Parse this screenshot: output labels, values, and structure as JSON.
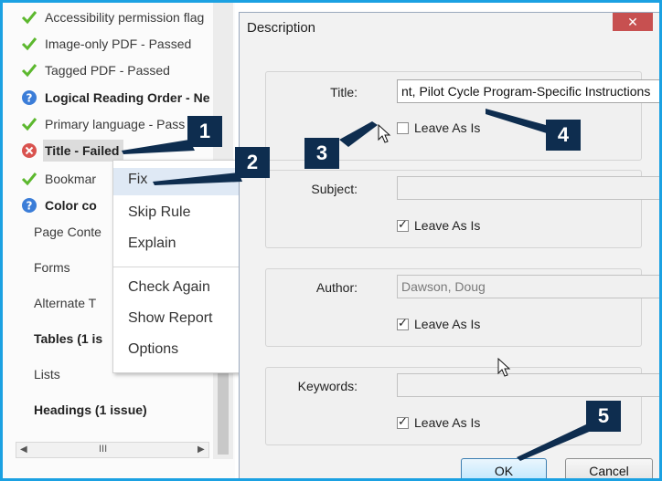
{
  "left_panel": {
    "items": [
      {
        "label": "Accessibility permission flag",
        "status": "passed"
      },
      {
        "label": "Image-only PDF - Passed",
        "status": "passed"
      },
      {
        "label": "Tagged PDF - Passed",
        "status": "passed"
      },
      {
        "label": "Logical Reading Order - Ne",
        "status": "manual"
      },
      {
        "label": "Primary language - Pass",
        "status": "passed"
      },
      {
        "label": "Title - Failed",
        "status": "failed"
      },
      {
        "label": "Bookmar",
        "status": "passed"
      },
      {
        "label": "Color co",
        "status": "manual"
      }
    ],
    "categories": [
      "Page Conte",
      "Forms",
      "Alternate T",
      "Tables (1 is",
      "Lists",
      "Headings (1 issue)"
    ],
    "scroll_grip": "III"
  },
  "context_menu": {
    "items": [
      "Fix",
      "Skip Rule",
      "Explain",
      "Check Again",
      "Show Report",
      "Options"
    ]
  },
  "dialog": {
    "title": "Description",
    "close": "✕",
    "fields": {
      "title": {
        "label": "Title:",
        "value": "nt, Pilot Cycle Program-Specific Instructions",
        "checkbox": "Leave As Is"
      },
      "subject": {
        "label": "Subject:",
        "value": "",
        "checkbox": "Leave As Is"
      },
      "author": {
        "label": "Author:",
        "value": "Dawson, Doug",
        "checkbox": "Leave As Is"
      },
      "keywords": {
        "label": "Keywords:",
        "value": "",
        "checkbox": "Leave As Is"
      }
    },
    "ok_label": "OK",
    "cancel_label": "Cancel"
  },
  "callouts": [
    "1",
    "2",
    "3",
    "4",
    "5"
  ],
  "colors": {
    "frame": "#1ba1e2",
    "callout": "#0e2d4f",
    "passed": "#5cb82e",
    "failed": "#d9534f",
    "manual": "#3b7dd8"
  }
}
